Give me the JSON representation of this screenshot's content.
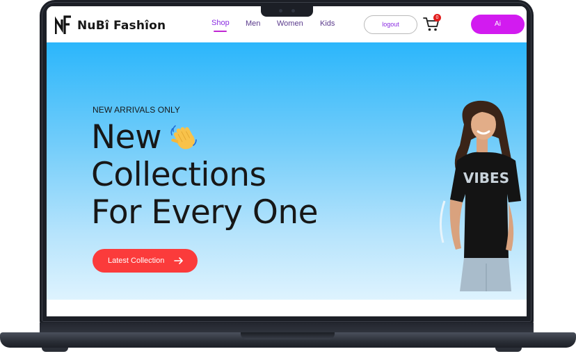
{
  "brand": {
    "logo_mark": "NF",
    "name": "NuBî Fashîon"
  },
  "nav": {
    "links": [
      {
        "label": "Shop",
        "active": true
      },
      {
        "label": "Men",
        "active": false
      },
      {
        "label": "Women",
        "active": false
      },
      {
        "label": "Kids",
        "active": false
      }
    ],
    "logout_label": "logout",
    "cart_count": "0",
    "ai_label": "Ai"
  },
  "hero": {
    "tagline": "NEW ARRIVALS ONLY",
    "headline_lines": [
      "New",
      "Collections",
      "For Every One"
    ],
    "cta_label": "Latest Collection",
    "shirt_text": "VIBES"
  },
  "colors": {
    "accent_purple": "#d21bf0",
    "cta_red": "#fb3b3b",
    "hero_top": "#2bb6fb",
    "hero_bottom": "#def3fe"
  },
  "icons": [
    "cart-icon",
    "waving-hand-icon",
    "arrow-right-icon"
  ]
}
